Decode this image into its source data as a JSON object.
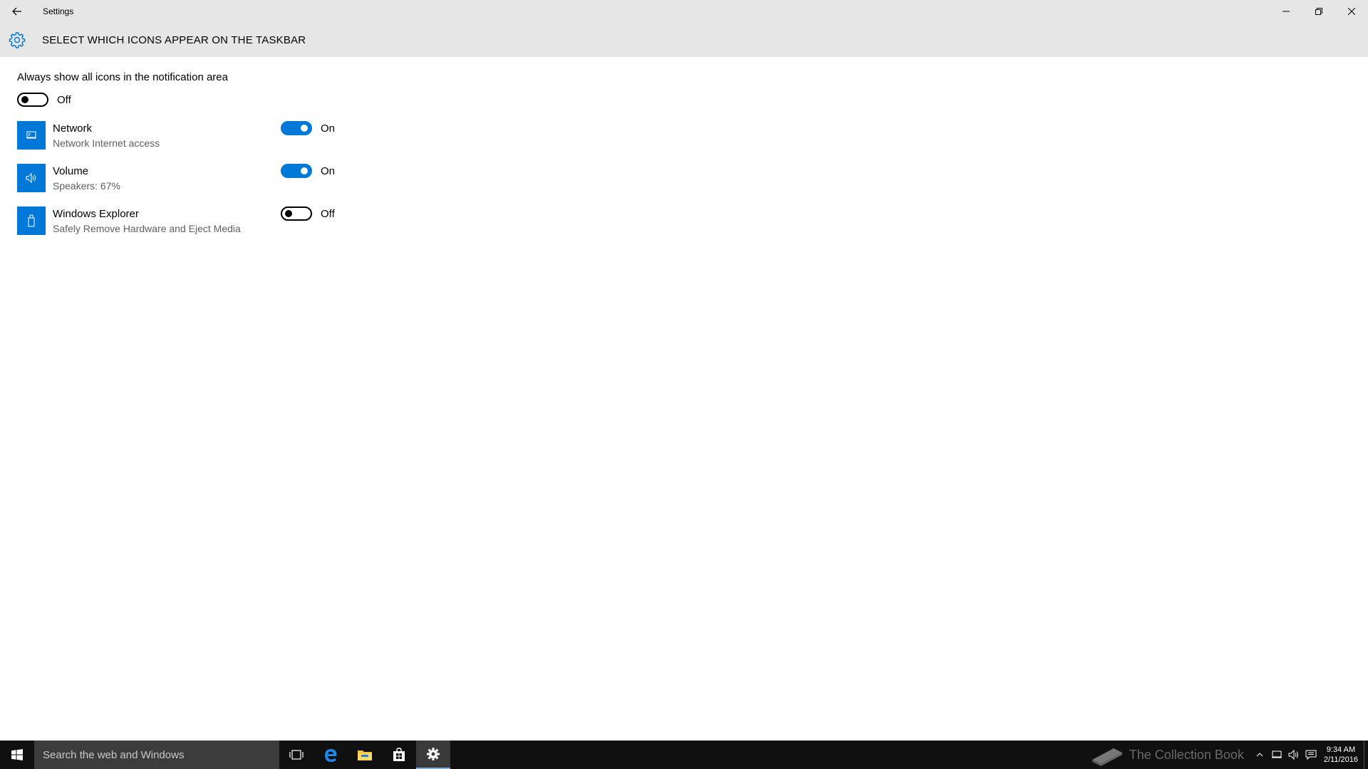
{
  "window": {
    "app_title": "Settings"
  },
  "header": {
    "title": "SELECT WHICH ICONS APPEAR ON THE TASKBAR",
    "icon": "gear-icon"
  },
  "always_show": {
    "label": "Always show all icons in the notification area",
    "state": "Off"
  },
  "icons": [
    {
      "title": "Network",
      "subtitle": "Network Internet access",
      "state": "On",
      "icon": "network-icon"
    },
    {
      "title": "Volume",
      "subtitle": "Speakers: 67%",
      "state": "On",
      "icon": "speaker-icon"
    },
    {
      "title": "Windows Explorer",
      "subtitle": "Safely Remove Hardware and Eject Media",
      "state": "Off",
      "icon": "usb-drive-icon"
    }
  ],
  "taskbar": {
    "search_placeholder": "Search the web and Windows",
    "watermark": "The Collection Book",
    "time": "9:34 AM",
    "date": "2/11/2016"
  },
  "colors": {
    "accent": "#0078d7",
    "titlebar": "#e6e6e6",
    "taskbar": "#101010"
  }
}
